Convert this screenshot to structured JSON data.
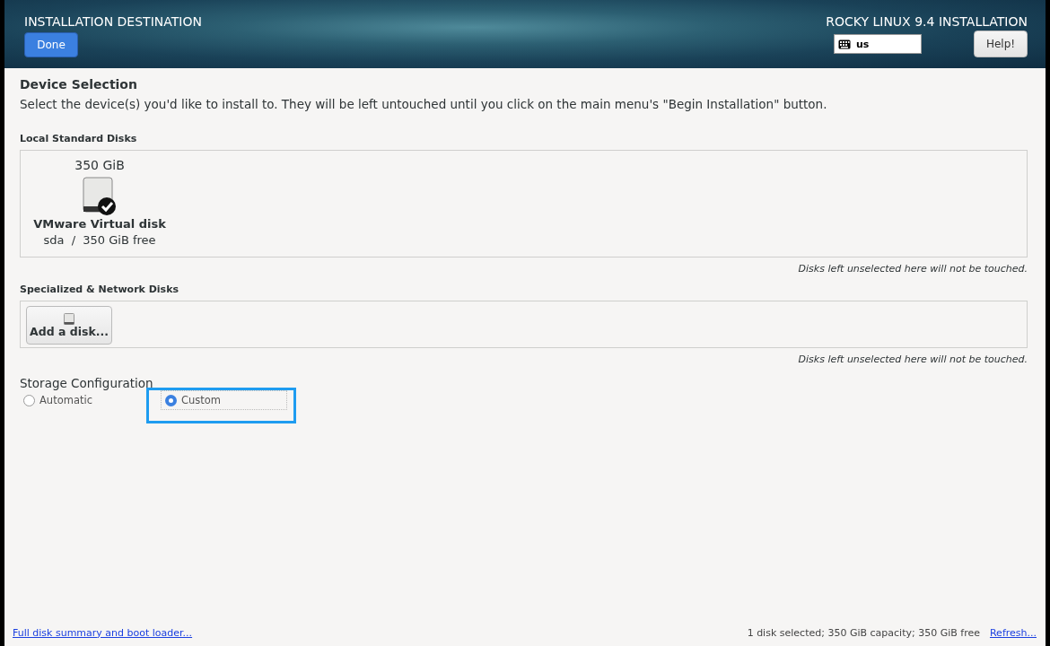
{
  "header": {
    "title": "INSTALLATION DESTINATION",
    "done_button": "Done",
    "product": "ROCKY LINUX 9.4 INSTALLATION",
    "keyboard_layout": "us",
    "help_button": "Help!"
  },
  "device_selection": {
    "title": "Device Selection",
    "description": "Select the device(s) you'd like to install to.  They will be left untouched until you click on the main menu's \"Begin Installation\" button."
  },
  "local_disks": {
    "title": "Local Standard Disks",
    "disks": [
      {
        "size": "350 GiB",
        "name": "VMware Virtual disk",
        "details": "sda  /  350 GiB free",
        "selected": true
      }
    ],
    "note": "Disks left unselected here will not be touched."
  },
  "specialized_disks": {
    "title": "Specialized & Network Disks",
    "add_button": "Add a disk...",
    "note": "Disks left unselected here will not be touched."
  },
  "storage_configuration": {
    "title": "Storage Configuration",
    "options": [
      {
        "label": "Automatic",
        "selected": false,
        "highlighted": false
      },
      {
        "label": "Custom",
        "selected": true,
        "highlighted": true
      }
    ]
  },
  "footer": {
    "summary_link": "Full disk summary and boot loader...",
    "status": "1 disk selected; 350 GiB capacity; 350 GiB free",
    "refresh_link": "Refresh..."
  }
}
